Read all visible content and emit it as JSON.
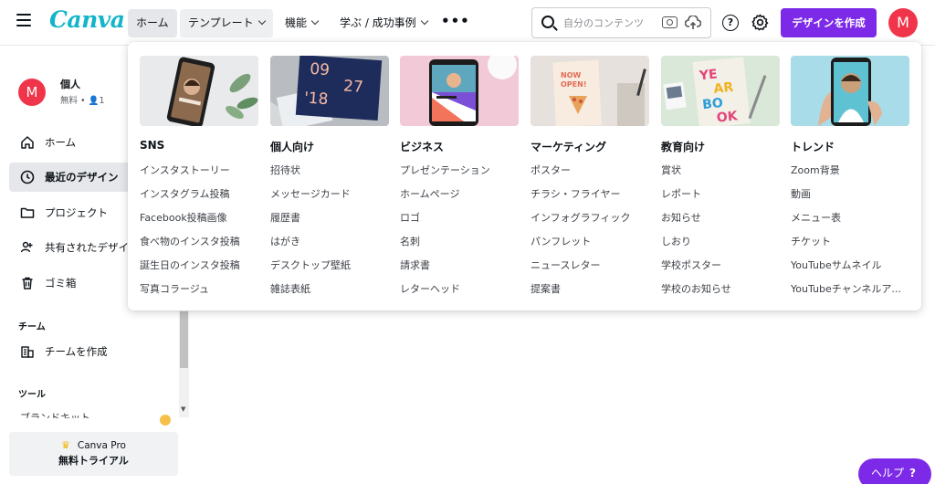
{
  "brand": {
    "logo_text": "Canva",
    "accent": "#7d2ae8",
    "logo_color": "#12b5c9",
    "avatar_color": "#f0354a"
  },
  "nav": {
    "home": "ホーム",
    "templates": "テンプレート",
    "features": "機能",
    "learn": "学ぶ / 成功事例",
    "more": "•••"
  },
  "search": {
    "placeholder": "自分のコンテンツ"
  },
  "header": {
    "help_glyph": "?",
    "create_label": "デザインを作成",
    "avatar_initial": "M"
  },
  "sidebar": {
    "user": {
      "initial": "M",
      "name": "個人",
      "plan": "無料 • 👤1"
    },
    "items": [
      {
        "label": "ホーム",
        "icon": "home-icon"
      },
      {
        "label": "最近のデザイン",
        "icon": "clock-icon"
      },
      {
        "label": "プロジェクト",
        "icon": "folder-icon"
      },
      {
        "label": "共有されたデザイン",
        "icon": "shared-users-icon"
      },
      {
        "label": "ゴミ箱",
        "icon": "trash-icon"
      }
    ],
    "team_section": "チーム",
    "team_item": "チームを作成",
    "tools_section": "ツール",
    "brandkit_fragment": "ブランドキット",
    "pro_line1": "Canva Pro",
    "pro_line2": "無料トライアル"
  },
  "menu": {
    "columns": [
      {
        "title": "SNS",
        "links": [
          "インスタストーリー",
          "インスタグラム投稿",
          "Facebook投稿画像",
          "食べ物のインスタ投稿",
          "誕生日のインスタ投稿",
          "写真コラージュ"
        ]
      },
      {
        "title": "個人向け",
        "links": [
          "招待状",
          "メッセージカード",
          "履歴書",
          "はがき",
          "デスクトップ壁紙",
          "雑誌表紙"
        ],
        "thumb_text": [
          "09",
          "27",
          "'18"
        ]
      },
      {
        "title": "ビジネス",
        "links": [
          "プレゼンテーション",
          "ホームページ",
          "ロゴ",
          "名刺",
          "請求書",
          "レターヘッド"
        ]
      },
      {
        "title": "マーケティング",
        "links": [
          "ポスター",
          "チラシ・フライヤー",
          "インフォグラフィック",
          "パンフレット",
          "ニュースレター",
          "提案書"
        ],
        "thumb_text": [
          "NOW",
          "OPEN!"
        ]
      },
      {
        "title": "教育向け",
        "links": [
          "賞状",
          "レポート",
          "お知らせ",
          "しおり",
          "学校ポスター",
          "学校のお知らせ"
        ],
        "thumb_text": [
          "YE",
          "AR",
          "BO",
          "OK"
        ]
      },
      {
        "title": "トレンド",
        "links": [
          "Zoom背景",
          "動画",
          "メニュー表",
          "チケット",
          "YouTubeサムネイル",
          "YouTubeチャンネルア..."
        ]
      }
    ]
  },
  "help_fab": {
    "label": "ヘルプ",
    "glyph": "?"
  }
}
